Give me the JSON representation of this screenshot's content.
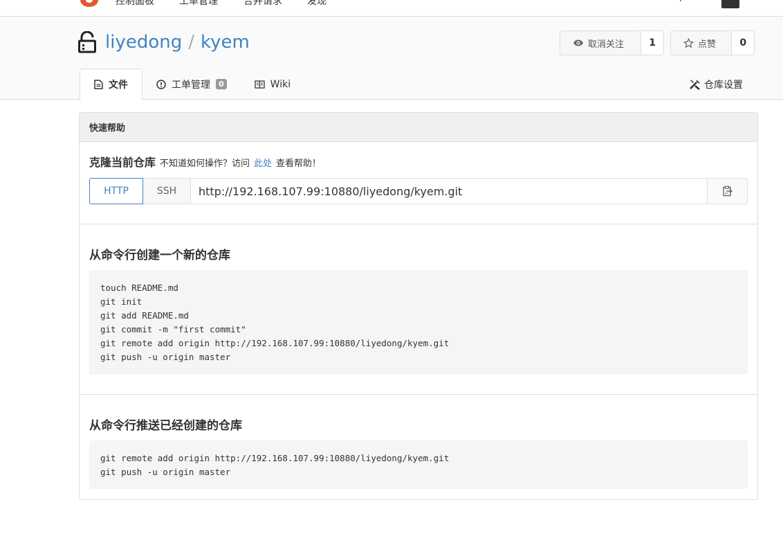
{
  "topnav": {
    "items": [
      "控制面板",
      "工单管理",
      "合并请求",
      "发现"
    ],
    "plus": "+"
  },
  "repo": {
    "owner": "liyedong",
    "separator": "/",
    "name": "kyem"
  },
  "actions": {
    "watch_label": "取消关注",
    "watch_count": "1",
    "star_label": "点赞",
    "star_count": "0"
  },
  "tabs": [
    {
      "label": "文件",
      "icon": "file-icon",
      "active": true
    },
    {
      "label": "工单管理",
      "icon": "issue-icon",
      "badge": "0"
    },
    {
      "label": "Wiki",
      "icon": "book-icon"
    }
  ],
  "settings_tab": {
    "label": "仓库设置",
    "icon": "tools-icon"
  },
  "quick_help": {
    "heading": "快速帮助",
    "clone_title": "克隆当前仓库",
    "clone_hint_before": "不知道如何操作？访问",
    "clone_hint_link": "此处",
    "clone_hint_after": "查看帮助！",
    "protocols": [
      "HTTP",
      "SSH"
    ],
    "clone_url": "http://192.168.107.99:10880/liyedong/kyem.git"
  },
  "new_repo": {
    "title": "从命令行创建一个新的仓库",
    "lines": [
      "touch README.md",
      "git init",
      "git add README.md",
      "git commit -m \"first commit\"",
      "git remote add origin http://192.168.107.99:10880/liyedong/kyem.git",
      "git push -u origin master"
    ]
  },
  "push_existing": {
    "title": "从命令行推送已经创建的仓库",
    "lines": [
      "git remote add origin http://192.168.107.99:10880/liyedong/kyem.git",
      "git push -u origin master"
    ]
  },
  "colors": {
    "link": "#4183c4",
    "border": "#dddddd",
    "header_bg": "#fafafa",
    "code_bg": "#f5f5f5"
  }
}
